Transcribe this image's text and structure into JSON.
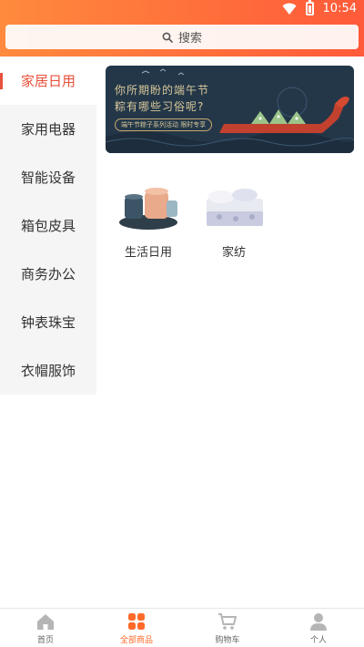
{
  "status": {
    "time": "10:54"
  },
  "search": {
    "placeholder": "搜索"
  },
  "sidebar": {
    "items": [
      {
        "label": "家居日用",
        "active": true
      },
      {
        "label": "家用电器",
        "active": false
      },
      {
        "label": "智能设备",
        "active": false
      },
      {
        "label": "箱包皮具",
        "active": false
      },
      {
        "label": "商务办公",
        "active": false
      },
      {
        "label": "钟表珠宝",
        "active": false
      },
      {
        "label": "衣帽服饰",
        "active": false
      }
    ]
  },
  "banner": {
    "line1": "你所期盼的端午节",
    "line2": "粽有哪些习俗呢?",
    "tag": "端午节粽子系列活动 限时专享"
  },
  "categories": [
    {
      "label": "生活日用",
      "icon": "tableware-image"
    },
    {
      "label": "家纺",
      "icon": "bedding-image"
    }
  ],
  "tabbar": {
    "items": [
      {
        "label": "首页",
        "icon": "home-icon",
        "active": false
      },
      {
        "label": "全部商品",
        "icon": "grid-icon",
        "active": true
      },
      {
        "label": "购物车",
        "icon": "cart-icon",
        "active": false
      },
      {
        "label": "个人",
        "icon": "person-icon",
        "active": false
      }
    ]
  },
  "colors": {
    "accent": "#ff6a2a",
    "active_category": "#e8513b"
  }
}
